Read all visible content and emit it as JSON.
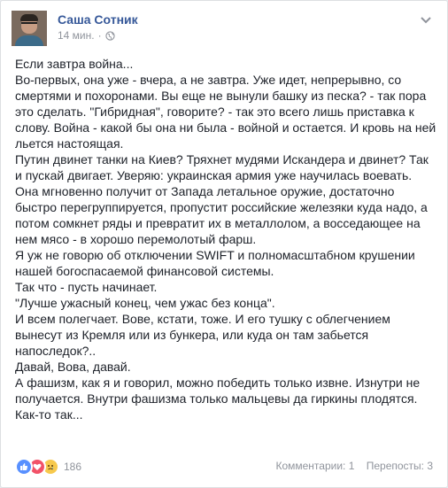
{
  "post": {
    "author": "Саша Сотник",
    "time": "14 мин.",
    "separator": "·",
    "paragraphs": [
      "Если завтра война...",
      "Во-первых, она уже - вчера, а не завтра. Уже идет, непрерывно, со смертями и похоронами. Вы еще не вынули башку из песка? - так пора это сделать. \"Гибридная\", говорите? - так это всего лишь приставка к слову. Война - какой бы она ни была - войной и остается. И кровь на ней льется настоящая.",
      "Путин двинет танки на Киев? Тряхнет мудями Искандера и двинет? Так и пускай двигает. Уверяю: украинская армия уже научилась воевать. Она мгновенно получит от Запада летальное оружие, достаточно быстро перегруппируется, пропустит российские железяки куда надо, а потом сомкнет ряды и превратит их в металлолом, а восседающее на нем мясо - в хорошо перемолотый фарш.",
      "Я уж не говорю об отключении SWIFT и полномасштабном крушении нашей богоспасаемой финансовой системы.",
      "Так что - пусть начинает.",
      "\"Лучше ужасный конец, чем ужас без конца\".",
      "И всем полегчает. Вове, кстати, тоже. И его тушку с облегчением вынесут из Кремля или из бункера, или куда он там забьется напоследок?..",
      "Давай, Вова, давай.",
      "А фашизм, как я и говорил, можно победить только извне. Изнутри не получается. Внутри фашизма только мальцевы да гиркины плодятся.",
      "Как-то так..."
    ]
  },
  "footer": {
    "reaction_count": "186",
    "comments": "Комментарии: 1",
    "shares": "Перепосты: 3"
  },
  "icons": {
    "privacy": "globe-icon",
    "menu": "chevron-down-icon",
    "reactions": [
      "like-icon",
      "love-icon",
      "sad-icon"
    ]
  },
  "colors": {
    "link": "#365899",
    "text": "#1d2129",
    "muted": "#90949c",
    "like": "#5890ff",
    "love": "#f25268",
    "sad": "#f7c94d"
  }
}
